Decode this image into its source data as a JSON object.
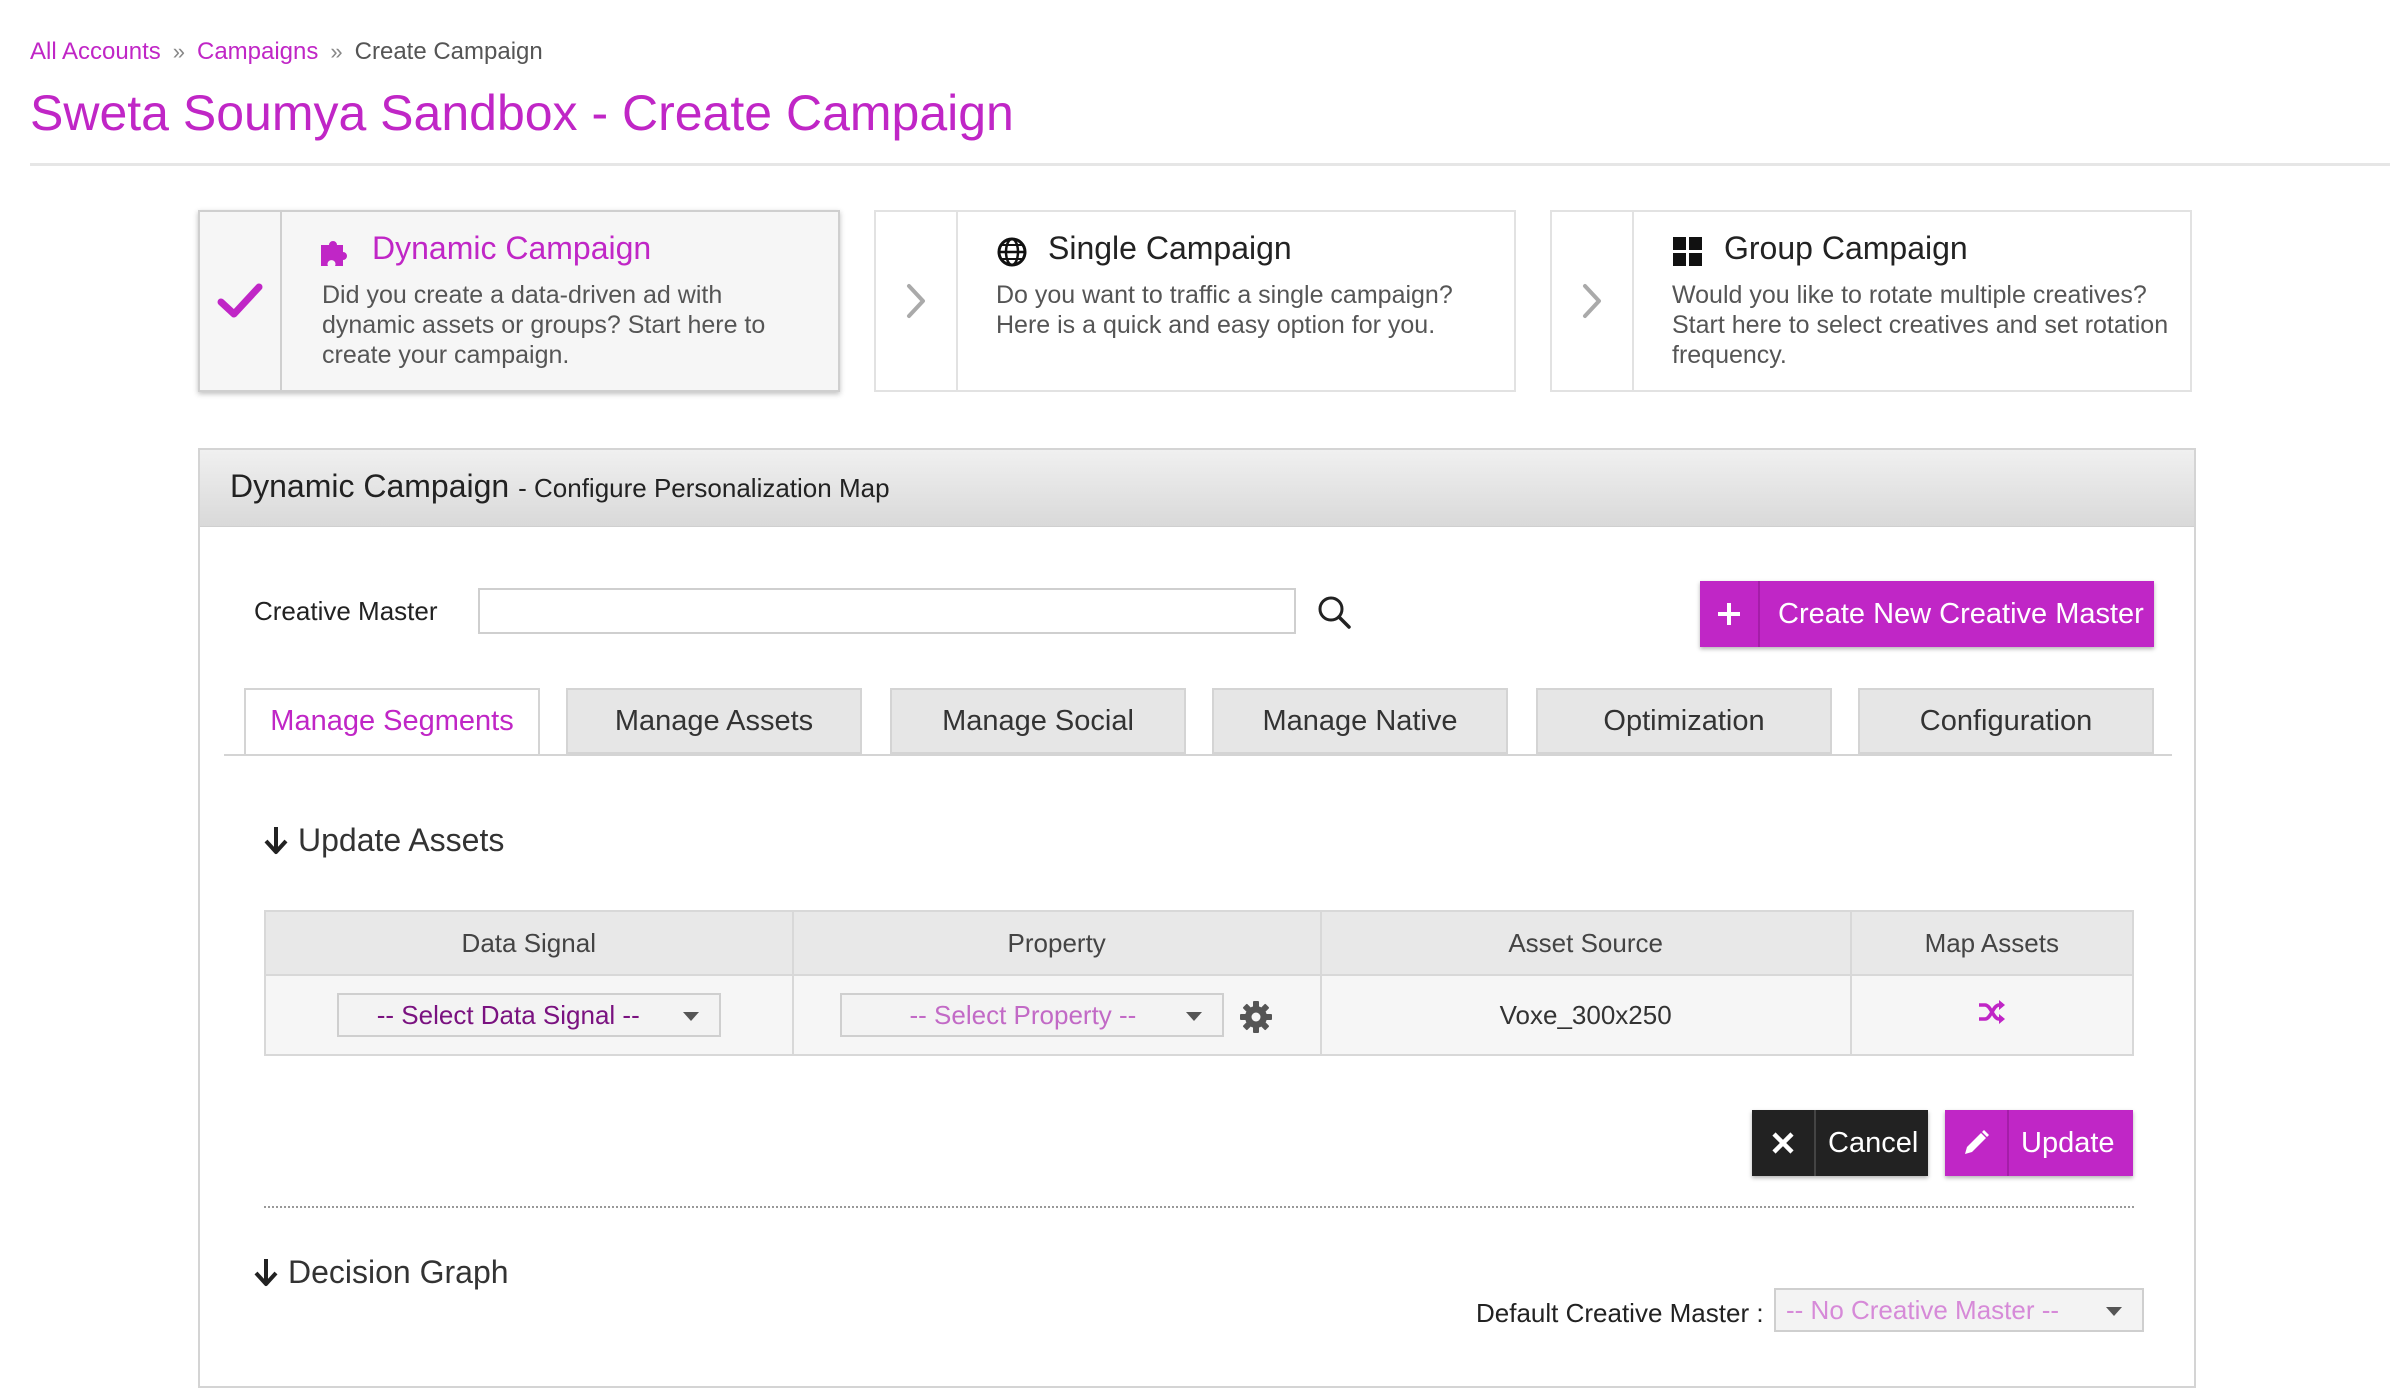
{
  "breadcrumb": {
    "items": [
      "All Accounts",
      "Campaigns",
      "Create Campaign"
    ],
    "separator": "»"
  },
  "page": {
    "title": "Sweta Soumya Sandbox - Create Campaign"
  },
  "campaign_types": [
    {
      "title": "Dynamic Campaign",
      "icon": "puzzle-icon",
      "selected": true,
      "description": "Did you create a data-driven ad with dynamic assets or groups? Start here to create your campaign."
    },
    {
      "title": "Single Campaign",
      "icon": "globe-icon",
      "selected": false,
      "description": "Do you want to traffic a single campaign? Here is a quick and easy option for you."
    },
    {
      "title": "Group Campaign",
      "icon": "grid-icon",
      "selected": false,
      "description": "Would you like to rotate multiple creatives? Start here to select creatives and set rotation frequency."
    }
  ],
  "panel": {
    "title": "Dynamic Campaign",
    "subtitle": "- Configure Personalization Map"
  },
  "creative_master": {
    "label": "Creative Master",
    "value": "",
    "create_button": "Create New Creative Master"
  },
  "tabs": [
    {
      "label": "Manage Segments",
      "active": true
    },
    {
      "label": "Manage Assets",
      "active": false
    },
    {
      "label": "Manage Social",
      "active": false
    },
    {
      "label": "Manage Native",
      "active": false
    },
    {
      "label": "Optimization",
      "active": false
    },
    {
      "label": "Configuration",
      "active": false
    }
  ],
  "update_assets": {
    "heading": "Update Assets",
    "columns": [
      "Data Signal",
      "Property",
      "Asset Source",
      "Map Assets"
    ],
    "rows": [
      {
        "data_signal": "-- Select Data Signal --",
        "property": "-- Select Property --",
        "asset_source": "Voxe_300x250",
        "map_icon": "shuffle-icon"
      }
    ],
    "cancel_label": "Cancel",
    "update_label": "Update"
  },
  "decision_graph": {
    "heading": "Decision Graph",
    "default_label": "Default Creative Master :",
    "default_value": "-- No Creative Master --"
  },
  "colors": {
    "accent": "#c026c6",
    "dark_button": "#222222",
    "header_gray": "#e0e0e0"
  }
}
